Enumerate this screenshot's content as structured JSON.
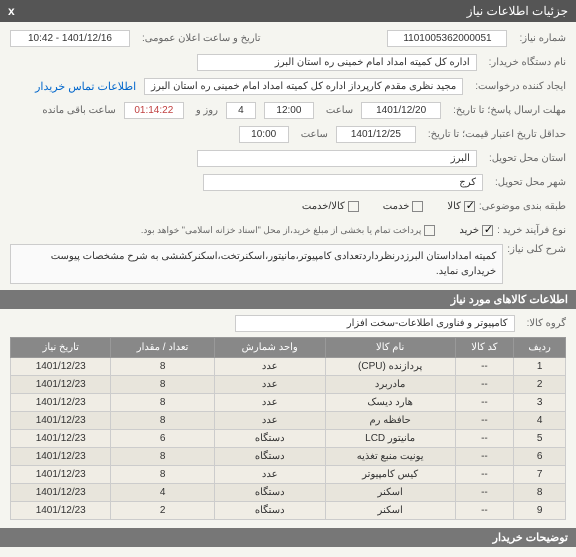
{
  "header": {
    "title": "جزئیات اطلاعات نیاز",
    "close": "x"
  },
  "fields": {
    "need_no_lbl": "شماره نیاز:",
    "need_no": "1101005362000051",
    "announce_lbl": "تاریخ و ساعت اعلان عمومی:",
    "announce": "1401/12/16 - 10:42",
    "buyer_name_lbl": "نام دستگاه خریدار:",
    "buyer_name": "اداره کل کمیته امداد امام خمینی  ره  استان البرز",
    "creator_lbl": "ایجاد کننده درخواست:",
    "creator": "مجید نظری مقدم کارپرداز اداره کل کمیته امداد امام خمینی  ره  استان البرز",
    "contact_link": "اطلاعات تماس خریدار",
    "reply_deadline_lbl": "مهلت ارسال پاسخ؛ تا تاریخ:",
    "reply_date": "1401/12/20",
    "time_lbl": "ساعت",
    "reply_time": "12:00",
    "day_lbl": "روز و",
    "days": "4",
    "remaining_lbl": "ساعت باقی مانده",
    "remaining": "01:14:22",
    "price_valid_lbl": "حداقل تاریخ اعتبار قیمت؛ تا تاریخ:",
    "price_date": "1401/12/25",
    "price_time": "10:00",
    "province_lbl": "استان محل تحویل:",
    "province": "البرز",
    "city_lbl": "شهر محل تحویل:",
    "city": "کرج",
    "category_lbl": "طبقه بندی موضوعی:",
    "cat_goods": "کالا",
    "cat_service": "خدمت",
    "cat_goods_service": "کالا/خدمت",
    "process_lbl": "نوع فرآیند خرید :",
    "process_buy": "خرید",
    "process_note": "پرداخت تمام یا بخشی از مبلغ خرید،از محل \"اسناد خزانه اسلامی\" خواهد بود.",
    "desc_lbl": "شرح کلی نیاز:",
    "desc": "کمیته امداداستان البرزدرنظرداردتعدادی کامپیوتر،مانیتور،اسکنرتخت،اسکنرکششی به شرح مشخصات پیوست خریداری نماید.",
    "items_section": "اطلاعات کالاهای مورد نیاز",
    "group_lbl": "گروه کالا:",
    "group": "کامپیوتر و فناوری اطلاعات-سخت افزار",
    "desc_section": "توضیحات خریدار"
  },
  "table": {
    "headers": [
      "ردیف",
      "کد کالا",
      "نام کالا",
      "واحد شمارش",
      "تعداد / مقدار",
      "تاریخ نیاز"
    ],
    "rows": [
      [
        "1",
        "--",
        "پردازنده (CPU)",
        "عدد",
        "8",
        "1401/12/23"
      ],
      [
        "2",
        "--",
        "مادربرد",
        "عدد",
        "8",
        "1401/12/23"
      ],
      [
        "3",
        "--",
        "هارد دیسک",
        "عدد",
        "8",
        "1401/12/23"
      ],
      [
        "4",
        "--",
        "حافظه رم",
        "عدد",
        "8",
        "1401/12/23"
      ],
      [
        "5",
        "--",
        "مانیتور LCD",
        "دستگاه",
        "6",
        "1401/12/23"
      ],
      [
        "6",
        "--",
        "یونیت منبع تغذیه",
        "دستگاه",
        "8",
        "1401/12/23"
      ],
      [
        "7",
        "--",
        "کیس کامپیوتر",
        "عدد",
        "8",
        "1401/12/23"
      ],
      [
        "8",
        "--",
        "اسکنر",
        "دستگاه",
        "4",
        "1401/12/23"
      ],
      [
        "9",
        "--",
        "اسکنر",
        "دستگاه",
        "2",
        "1401/12/23"
      ]
    ]
  }
}
